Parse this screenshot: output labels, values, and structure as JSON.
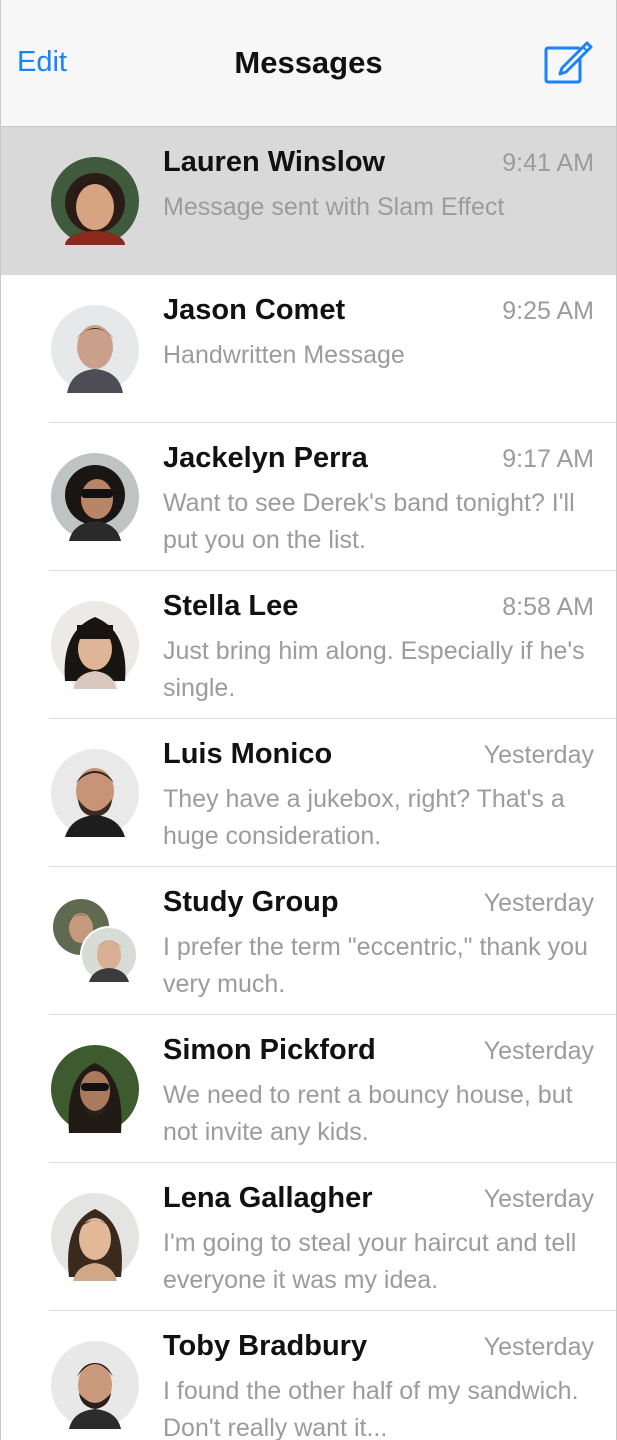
{
  "nav": {
    "edit_label": "Edit",
    "title": "Messages",
    "compose_icon": "compose-icon",
    "accent_color": "#1a82fb"
  },
  "conversations": [
    {
      "name": "Lauren Winslow",
      "time": "9:41 AM",
      "preview": "Message sent with Slam Effect",
      "selected": true
    },
    {
      "name": "Jason Comet",
      "time": "9:25 AM",
      "preview": "Handwritten Message"
    },
    {
      "name": "Jackelyn Perra",
      "time": "9:17 AM",
      "preview": "Want to see Derek's band tonight? I'll put you on the list."
    },
    {
      "name": "Stella Lee",
      "time": "8:58 AM",
      "preview": "Just bring him along. Especially if he's single."
    },
    {
      "name": "Luis Monico",
      "time": "Yesterday",
      "preview": "They have a jukebox, right? That's a huge consideration."
    },
    {
      "name": "Study Group",
      "time": "Yesterday",
      "preview": "I prefer the term \"eccentric,\" thank you very much."
    },
    {
      "name": "Simon Pickford",
      "time": "Yesterday",
      "preview": "We need to rent a bouncy house, but not invite any kids."
    },
    {
      "name": "Lena Gallagher",
      "time": "Yesterday",
      "preview": "I'm going to steal your haircut and tell everyone it was my idea."
    },
    {
      "name": "Toby Bradbury",
      "time": "Yesterday",
      "preview": "I found the other half of my sandwich. Don't really want it..."
    }
  ]
}
